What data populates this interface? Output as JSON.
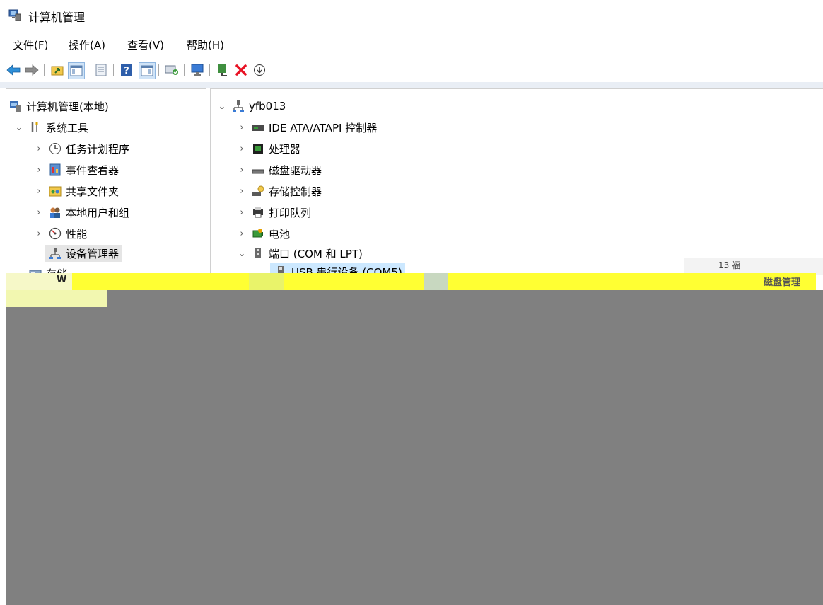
{
  "window": {
    "title": "计算机管理"
  },
  "menu": [
    "文件(F)",
    "操作(A)",
    "查看(V)",
    "帮助(H)"
  ],
  "toolbar": {
    "buttons": [
      "back-arrow-icon",
      "forward-arrow-icon",
      "up-folder-icon",
      "show-hide-tree-icon",
      "properties-icon",
      "help-icon",
      "show-hide-action-pane-icon",
      "scan-hardware-icon",
      "monitor-icon",
      "enable-device-icon",
      "uninstall-x-icon",
      "download-icon"
    ]
  },
  "left_tree": {
    "root": "计算机管理(本地)",
    "system_tools": "系统工具",
    "children": [
      "任务计划程序",
      "事件查看器",
      "共享文件夹",
      "本地用户和组",
      "性能",
      "设备管理器"
    ],
    "storage": "存储",
    "storage_fragment": "W"
  },
  "device_tree": {
    "computer": "yfb013",
    "categories": [
      "IDE ATA/ATAPI 控制器",
      "处理器",
      "磁盘驱动器",
      "存储控制器",
      "打印队列",
      "电池",
      "端口 (COM 和 LPT)"
    ],
    "port_child": "USB 串行设备 (COM5)"
  },
  "glitch_fragments": {
    "right_a": "磁盘管理",
    "right_b": "13 福"
  },
  "colors": {
    "accent_blue": "#3a7bd5",
    "selection_gray": "#e5e5e5",
    "glitch_yellow": "#ffff33",
    "glitch_gray": "#808080",
    "delete_red": "#e81123"
  }
}
